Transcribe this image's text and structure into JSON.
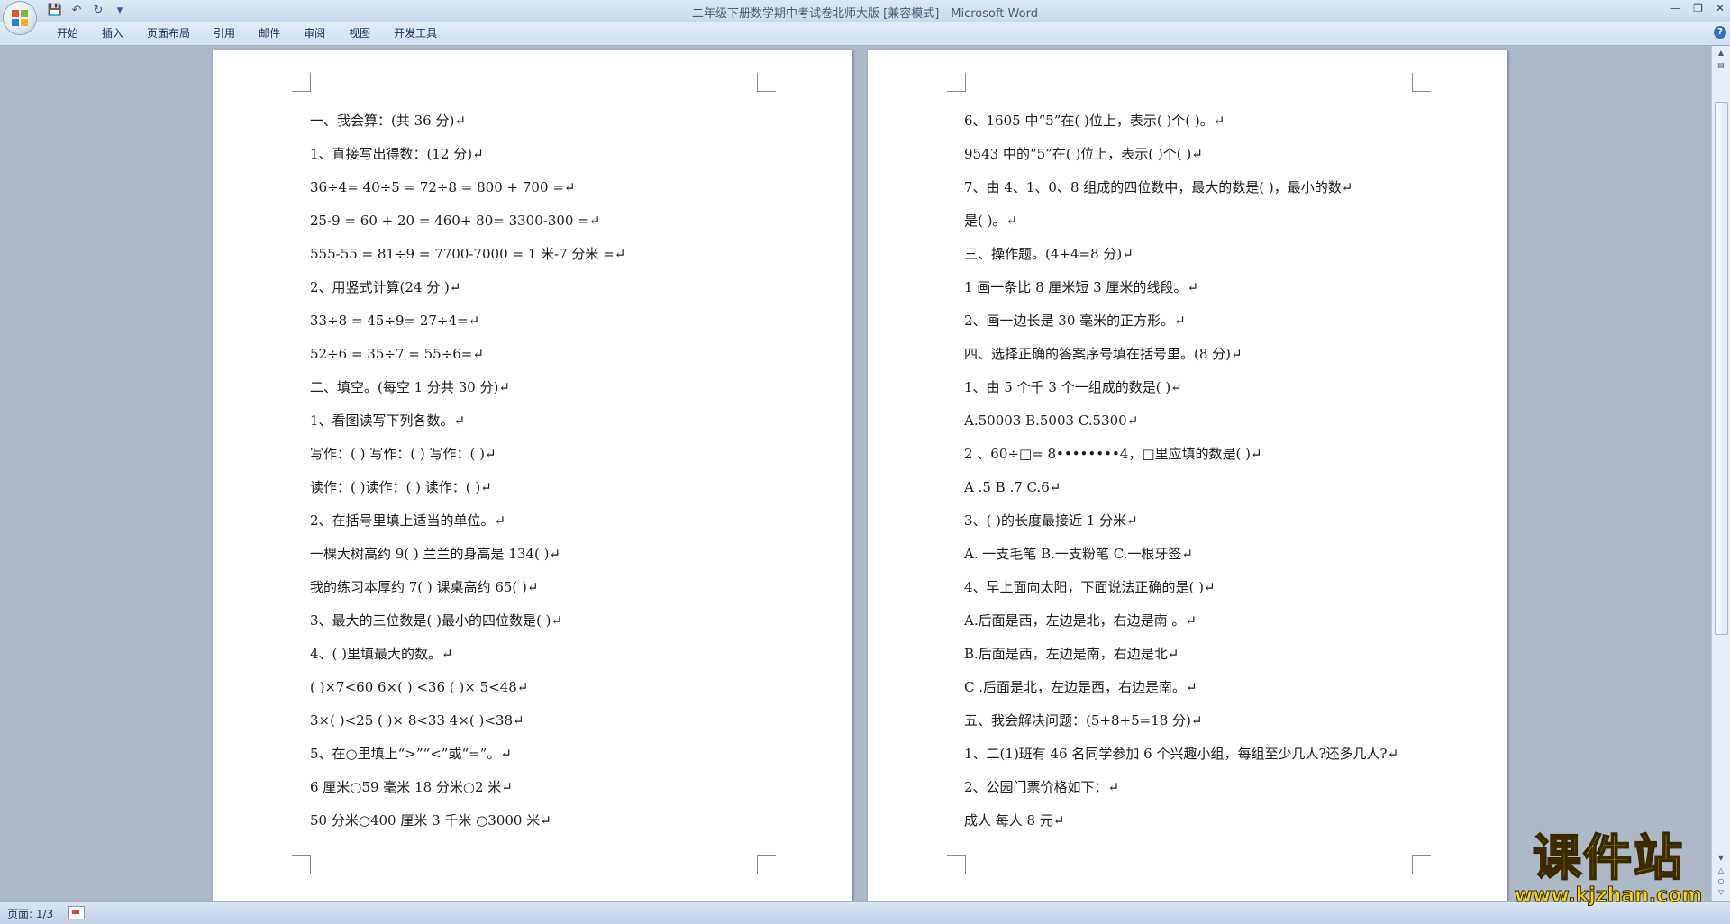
{
  "window": {
    "title": "二年级下册数学期中考试卷北师大版 [兼容模式] - Microsoft Word",
    "quick_access": [
      "save-icon",
      "undo-icon",
      "redo-icon",
      "customize-icon"
    ]
  },
  "ribbon": {
    "tabs": [
      "开始",
      "插入",
      "页面布局",
      "引用",
      "邮件",
      "审阅",
      "视图",
      "开发工具"
    ]
  },
  "document": {
    "page_left": {
      "lines": [
        "一、我会算：(共 36 分)↵",
        "1、直接写出得数：(12 分)↵",
        "36÷4= 40÷5 = 72÷8 = 800 + 700 =↵",
        "25-9 = 60 + 20 = 460+ 80= 3300-300 =↵",
        "555-55 = 81÷9 = 7700-7000 = 1 米-7 分米 =↵",
        "2、用竖式计算(24 分 )↵",
        "33÷8 = 45÷9= 27÷4=↵",
        "52÷6 = 35÷7 = 55÷6=↵",
        "二、填空。(每空 1 分共 30 分)↵",
        "1、看图读写下列各数。↵",
        "写作：( ) 写作：( ) 写作：( )↵",
        "读作：( )读作：( ) 读作：( )↵",
        "2、在括号里填上适当的单位。↵",
        "一棵大树高约 9( ) 兰兰的身高是 134( )↵",
        "我的练习本厚约 7( ) 课桌高约 65( )↵",
        "3、最大的三位数是( )最小的四位数是( )↵",
        "4、( )里填最大的数。↵",
        "( )×7<60 6×( ) <36 ( )× 5<48↵",
        "3×( )<25 ( )× 8<33 4×( )<38↵",
        "5、在○里填上“>”“<”或“=”。↵",
        "6 厘米○59 毫米 18 分米○2 米↵",
        "50 分米○400 厘米 3 千米 ○3000 米↵"
      ]
    },
    "page_right": {
      "lines": [
        "6、1605 中“5”在( )位上，表示( )个( )。↵",
        "9543 中的“5”在( )位上，表示( )个( )↵",
        "7、由 4、1、0、8 组成的四位数中，最大的数是( )，最小的数↵",
        "是(           )。↵",
        "三、操作题。(4+4=8 分)↵",
        "1 画一条比 8 厘米短 3 厘米的线段。↵",
        "2、画一边长是 30 毫米的正方形。↵",
        "四、选择正确的答案序号填在括号里。(8 分)↵",
        "1、由 5 个千 3 个一组成的数是( )↵",
        "A.50003 B.5003 C.5300↵",
        "2 、60÷□= 8••••••••4，□里应填的数是( )↵",
        "A .5 B .7 C.6↵",
        "3、( )的长度最接近 1 分米↵",
        "A. 一支毛笔 B.一支粉笔 C.一根牙签↵",
        "4、早上面向太阳，下面说法正确的是( )↵",
        "A.后面是西，左边是北，右边是南 。↵",
        "B.后面是西，左边是南，右边是北↵",
        "C .后面是北，左边是西，右边是南。↵",
        "五、我会解决问题：(5+8+5=18 分)↵",
        "1、二(1)班有 46 名同学参加 6 个兴趣小组，每组至少几人?还多几人?↵",
        "2、公园门票价格如下：↵",
        "成人 每人 8 元↵"
      ]
    }
  },
  "statusbar": {
    "page_info": "页面: 1/3"
  },
  "watermark": {
    "main": "课件站",
    "url": "www.kjzhan.com"
  }
}
